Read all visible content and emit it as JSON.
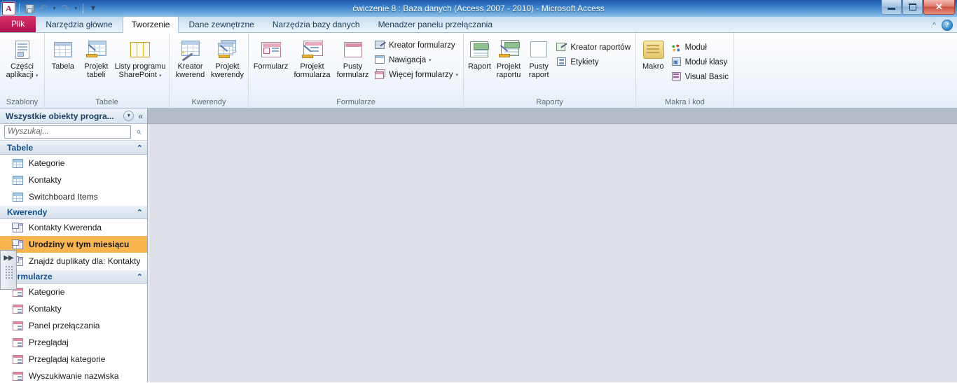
{
  "window": {
    "title": "ćwiczenie 8 : Baza danych (Access 2007 - 2010)  -  Microsoft Access",
    "app_orb": "A",
    "minimize_label": "Minimalizuj",
    "restore_label": "Przywróć w dół",
    "close_label": "Zamknij"
  },
  "quick_access": {
    "save": "Zapisz",
    "undo": "Cofnij",
    "redo": "Wykonaj ponownie",
    "customize": "Dostosuj pasek narzędzi Szybki dostęp"
  },
  "tabs": {
    "file": "Plik",
    "items": [
      {
        "label": "Narzędzia główne",
        "active": false
      },
      {
        "label": "Tworzenie",
        "active": true
      },
      {
        "label": "Dane zewnętrzne",
        "active": false
      },
      {
        "label": "Narzędzia bazy danych",
        "active": false
      },
      {
        "label": "Menadzer panelu przełączania",
        "active": false
      }
    ],
    "collapse_ribbon": "^",
    "help": "?"
  },
  "ribbon": {
    "groups": [
      {
        "name": "Szablony",
        "label": "Szablony",
        "big_buttons": [
          {
            "label_line1": "Części",
            "label_line2": "aplikacji",
            "icon": "application-parts-icon",
            "has_dropdown": true
          }
        ],
        "small_buttons": []
      },
      {
        "name": "Tabele",
        "label": "Tabele",
        "big_buttons": [
          {
            "label_line1": "Tabela",
            "label_line2": "",
            "icon": "table-icon",
            "has_dropdown": false
          },
          {
            "label_line1": "Projekt",
            "label_line2": "tabeli",
            "icon": "table-design-icon",
            "has_dropdown": false
          },
          {
            "label_line1": "Listy programu",
            "label_line2": "SharePoint",
            "icon": "sharepoint-lists-icon",
            "has_dropdown": true
          }
        ],
        "small_buttons": []
      },
      {
        "name": "Kwerendy",
        "label": "Kwerendy",
        "big_buttons": [
          {
            "label_line1": "Kreator",
            "label_line2": "kwerend",
            "icon": "query-wizard-icon",
            "has_dropdown": false
          },
          {
            "label_line1": "Projekt",
            "label_line2": "kwerendy",
            "icon": "query-design-icon",
            "has_dropdown": false
          }
        ],
        "small_buttons": []
      },
      {
        "name": "Formularze",
        "label": "Formularze",
        "big_buttons": [
          {
            "label_line1": "Formularz",
            "label_line2": "",
            "icon": "form-icon",
            "has_dropdown": false
          },
          {
            "label_line1": "Projekt",
            "label_line2": "formularza",
            "icon": "form-design-icon",
            "has_dropdown": false
          },
          {
            "label_line1": "Pusty",
            "label_line2": "formularz",
            "icon": "blank-form-icon",
            "has_dropdown": false
          }
        ],
        "small_buttons": [
          {
            "label": "Kreator formularzy",
            "icon": "form-wizard-icon",
            "has_dropdown": false
          },
          {
            "label": "Nawigacja",
            "icon": "navigation-icon",
            "has_dropdown": true
          },
          {
            "label": "Więcej formularzy",
            "icon": "more-forms-icon",
            "has_dropdown": true
          }
        ]
      },
      {
        "name": "Raporty",
        "label": "Raporty",
        "big_buttons": [
          {
            "label_line1": "Raport",
            "label_line2": "",
            "icon": "report-icon",
            "has_dropdown": false
          },
          {
            "label_line1": "Projekt",
            "label_line2": "raportu",
            "icon": "report-design-icon",
            "has_dropdown": false
          },
          {
            "label_line1": "Pusty",
            "label_line2": "raport",
            "icon": "blank-report-icon",
            "has_dropdown": false
          }
        ],
        "small_buttons": [
          {
            "label": "Kreator raportów",
            "icon": "report-wizard-icon",
            "has_dropdown": false
          },
          {
            "label": "Etykiety",
            "icon": "labels-icon",
            "has_dropdown": false
          }
        ]
      },
      {
        "name": "Makra i kod",
        "label": "Makra i kod",
        "big_buttons": [
          {
            "label_line1": "Makro",
            "label_line2": "",
            "icon": "macro-icon",
            "has_dropdown": false
          }
        ],
        "small_buttons": [
          {
            "label": "Moduł",
            "icon": "module-icon",
            "has_dropdown": false
          },
          {
            "label": "Moduł klasy",
            "icon": "class-module-icon",
            "has_dropdown": false
          },
          {
            "label": "Visual Basic",
            "icon": "visual-basic-icon",
            "has_dropdown": false
          }
        ]
      }
    ]
  },
  "navigation_pane": {
    "header_title": "Wszystkie obiekty progra...",
    "dropdown_icon": "chevron-down-icon",
    "collapse_icon": "double-chevron-left-icon",
    "search_placeholder": "Wyszukaj...",
    "search_value": "",
    "search_icon": "search-icon",
    "shutter_arrows": "▶▶",
    "groups": [
      {
        "title": "Tabele",
        "chevron": "collapse-chevron-icon",
        "items": [
          {
            "label": "Kategorie",
            "icon": "table-object-icon",
            "selected": false
          },
          {
            "label": "Kontakty",
            "icon": "table-object-icon",
            "selected": false
          },
          {
            "label": "Switchboard Items",
            "icon": "table-object-icon",
            "selected": false
          }
        ]
      },
      {
        "title": "Kwerendy",
        "chevron": "collapse-chevron-icon",
        "items": [
          {
            "label": "Kontakty Kwerenda",
            "icon": "query-object-icon",
            "selected": false
          },
          {
            "label": "Urodziny w tym miesiącu",
            "icon": "query-object-icon",
            "selected": true
          },
          {
            "label": "Znajdź duplikaty dla: Kontakty",
            "icon": "query-object-icon",
            "selected": false
          }
        ]
      },
      {
        "title": "Formularze",
        "chevron": "collapse-chevron-icon",
        "items": [
          {
            "label": "Kategorie",
            "icon": "form-object-icon",
            "selected": false
          },
          {
            "label": "Kontakty",
            "icon": "form-object-icon",
            "selected": false
          },
          {
            "label": "Panel przełączania",
            "icon": "form-object-icon",
            "selected": false
          },
          {
            "label": "Przeglądaj",
            "icon": "form-object-icon",
            "selected": false
          },
          {
            "label": "Przeglądaj kategorie",
            "icon": "form-object-icon",
            "selected": false
          },
          {
            "label": "Wyszukiwanie nazwiska",
            "icon": "form-object-icon",
            "selected": false
          }
        ]
      }
    ]
  },
  "colors": {
    "selection": "#f8b54f",
    "file_tab": "#c01f5c",
    "title_bar": "#2f74c0",
    "group_header_text": "#14508c",
    "doc_background": "#dce0e6"
  }
}
